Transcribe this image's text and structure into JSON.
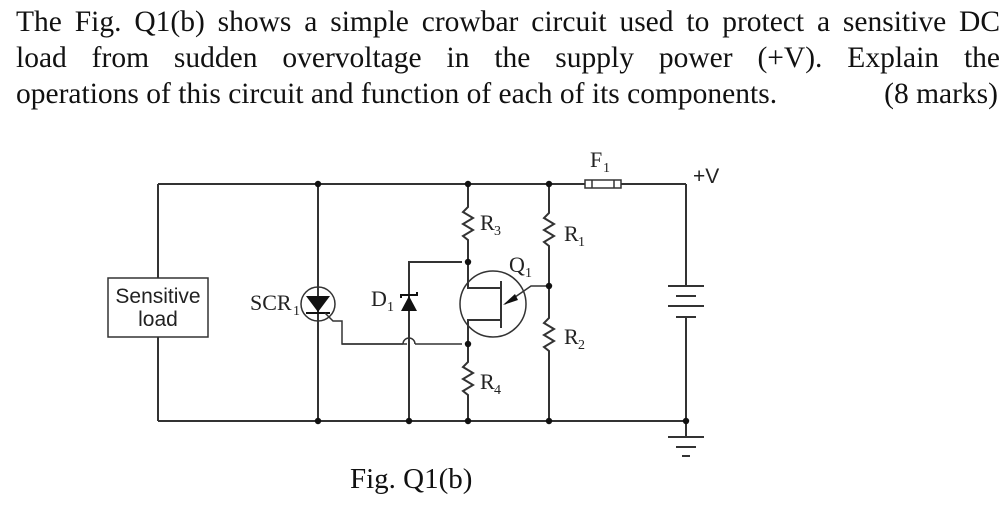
{
  "question": {
    "lines": [
      "The Fig. Q1(b) shows a simple crowbar circuit used to protect a sensitive DC",
      "load from sudden overvoltage in the supply power (+V). Explain the",
      "operations of this circuit and function of each of its components."
    ],
    "marks": "(8 marks)"
  },
  "figure": {
    "caption": "Fig. Q1(b)",
    "components": {
      "load": {
        "line1": "Sensitive",
        "line2": "load"
      },
      "scr": {
        "name": "SCR",
        "sub": "1"
      },
      "zener": {
        "name": "D",
        "sub": "1"
      },
      "r1": {
        "name": "R",
        "sub": "1"
      },
      "r2": {
        "name": "R",
        "sub": "2"
      },
      "r3": {
        "name": "R",
        "sub": "3"
      },
      "r4": {
        "name": "R",
        "sub": "4"
      },
      "q1": {
        "name": "Q",
        "sub": "1"
      },
      "fuse": {
        "name": "F",
        "sub": "1"
      },
      "supply": {
        "label": "+V"
      }
    }
  }
}
